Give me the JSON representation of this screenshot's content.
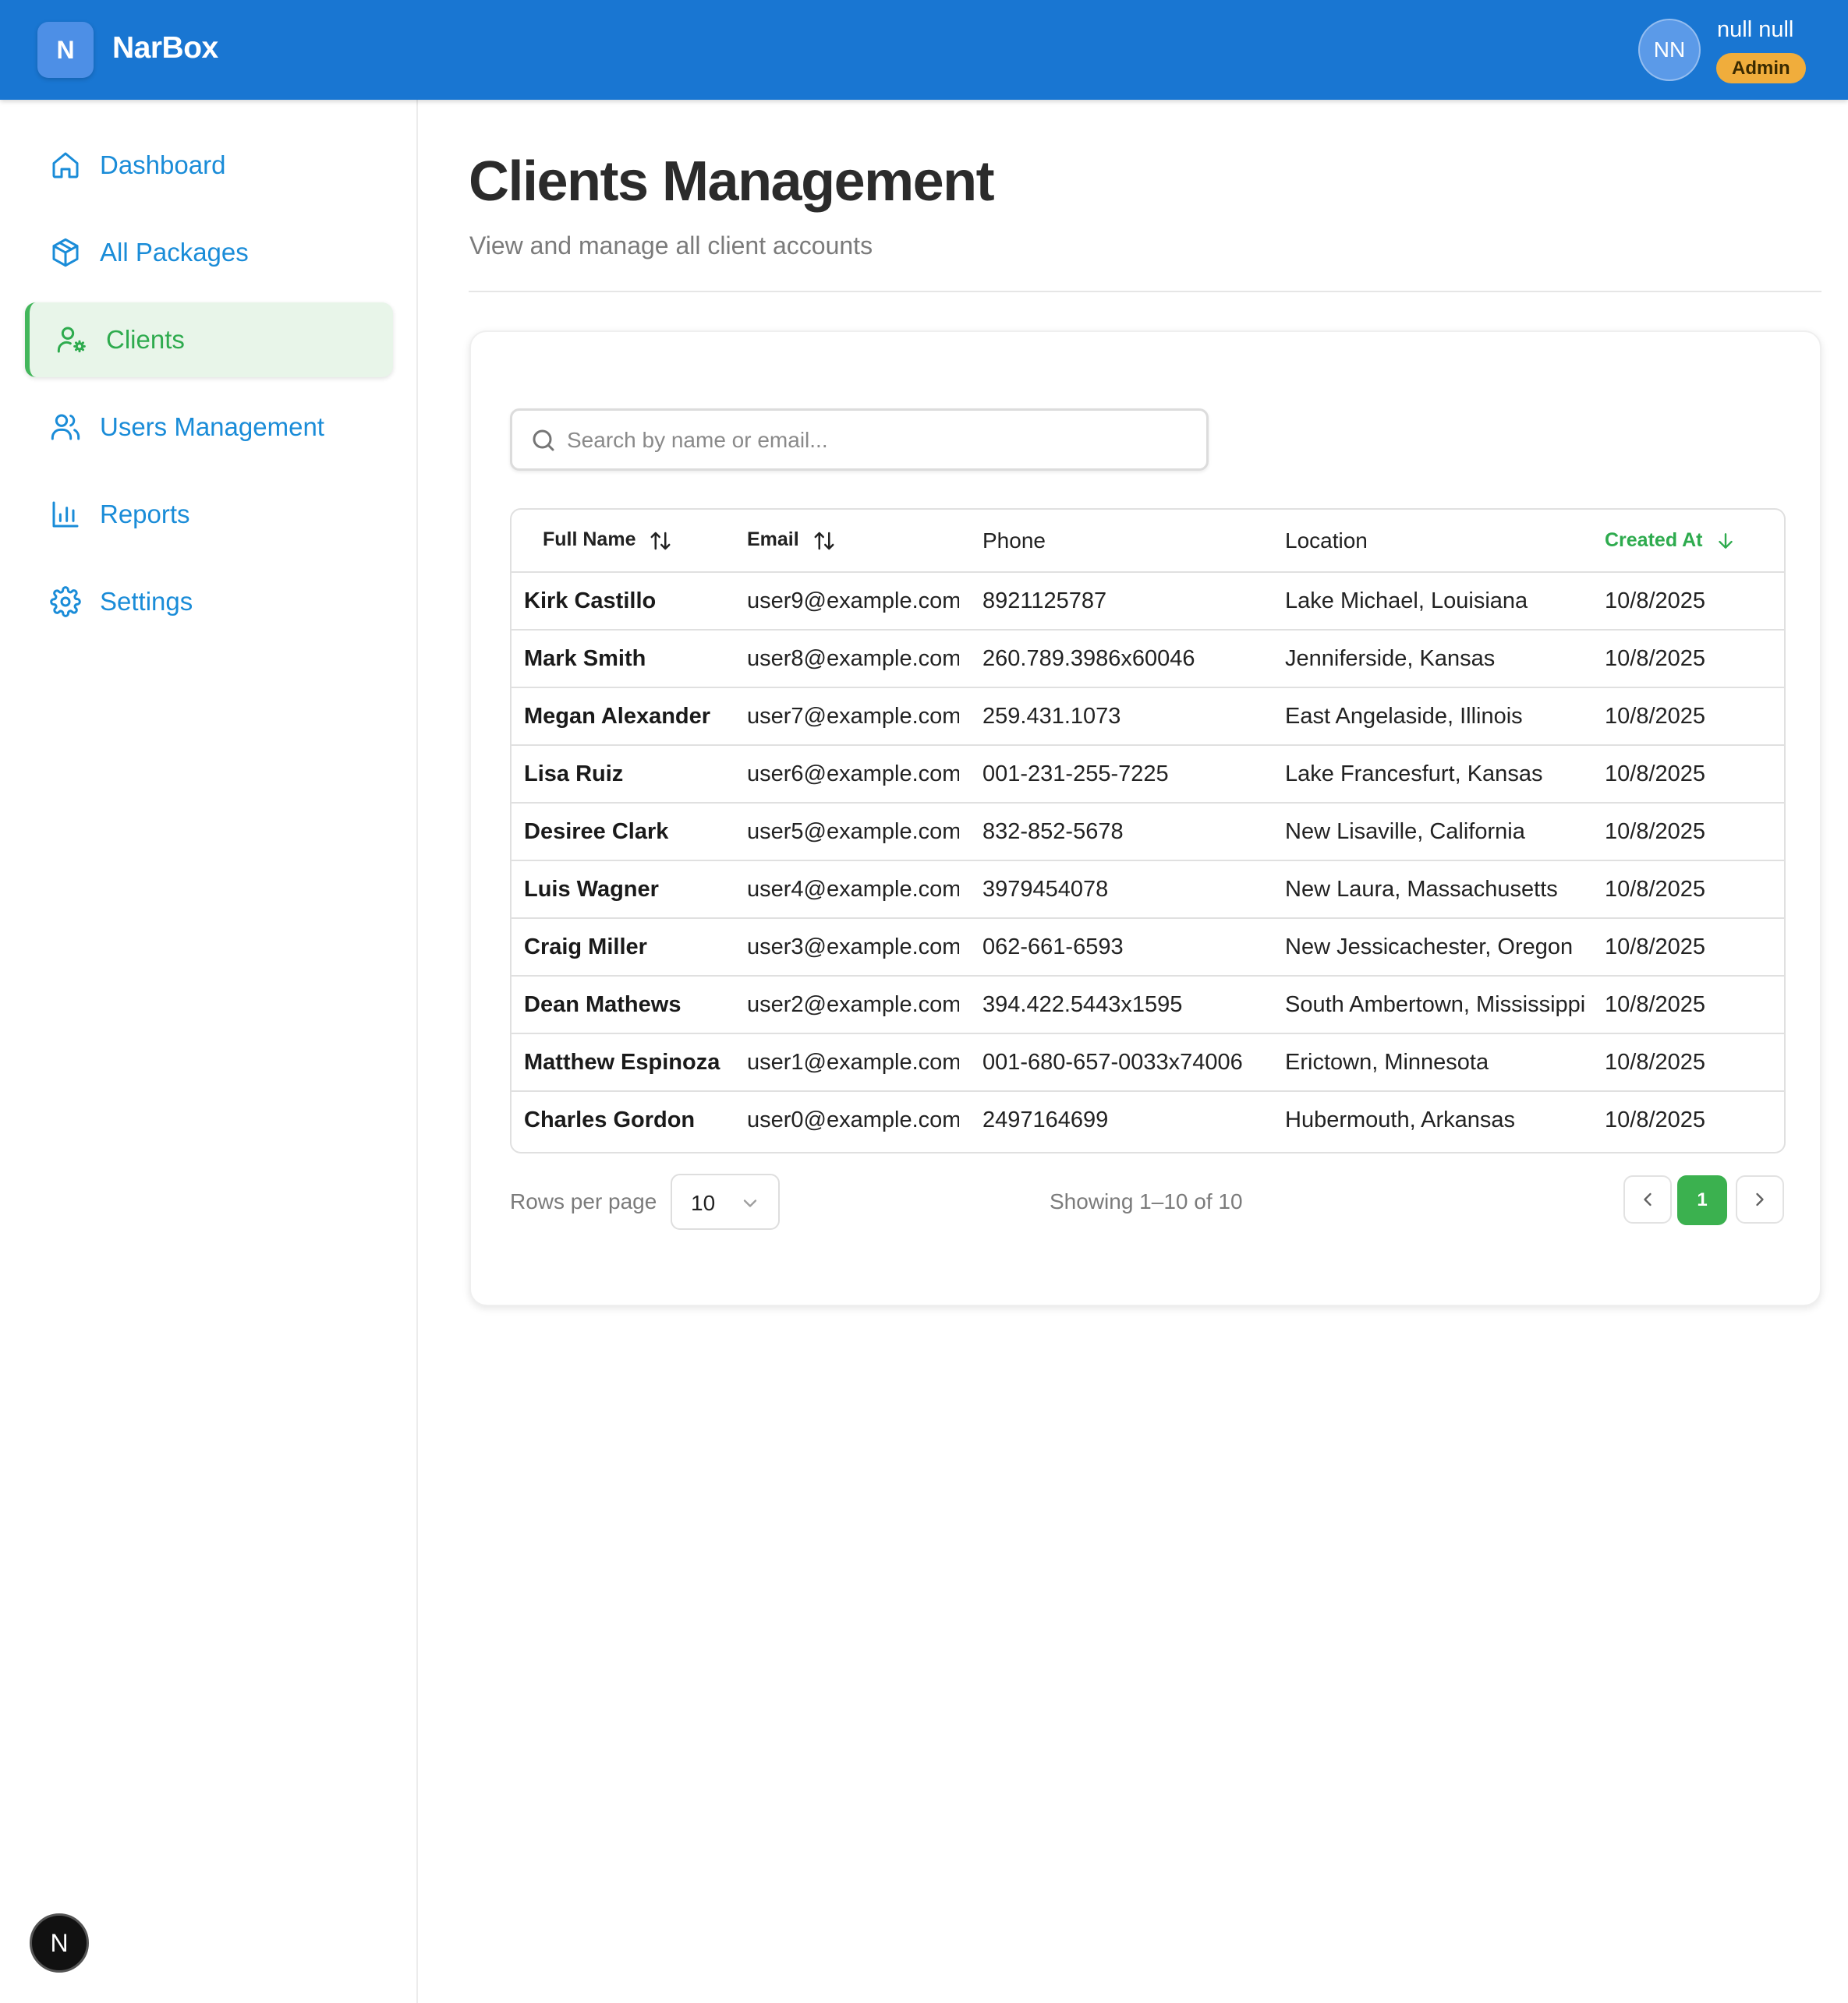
{
  "header": {
    "logo_letter": "N",
    "app_name": "NarBox",
    "user_initials": "NN",
    "user_name": "null null",
    "user_role": "Admin",
    "accent": "#1976d2"
  },
  "sidebar": {
    "items": [
      {
        "label": "Dashboard",
        "icon": "home-icon",
        "active": false
      },
      {
        "label": "All Packages",
        "icon": "package-icon",
        "active": false
      },
      {
        "label": "Clients",
        "icon": "user-cog-icon",
        "active": true
      },
      {
        "label": "Users Management",
        "icon": "users-icon",
        "active": false
      },
      {
        "label": "Reports",
        "icon": "bar-chart-icon",
        "active": false
      },
      {
        "label": "Settings",
        "icon": "gear-icon",
        "active": false
      }
    ],
    "active_color": "#2eab4e",
    "link_color": "#1a8cd8"
  },
  "dev_badge": {
    "letter": "N"
  },
  "page": {
    "title": "Clients Management",
    "subtitle": "View and manage all client accounts"
  },
  "search": {
    "placeholder": "Search by name or email...",
    "value": ""
  },
  "table": {
    "columns": [
      {
        "label": "Full Name",
        "sort": "both"
      },
      {
        "label": "Email",
        "sort": "both"
      },
      {
        "label": "Phone",
        "sort": "none"
      },
      {
        "label": "Location",
        "sort": "none"
      },
      {
        "label": "Created At",
        "sort": "desc"
      }
    ],
    "rows": [
      [
        "Kirk Castillo",
        "user9@example.com",
        "8921125787",
        "Lake Michael, Louisiana",
        "10/8/2025"
      ],
      [
        "Mark Smith",
        "user8@example.com",
        "260.789.3986x60046",
        "Jenniferside, Kansas",
        "10/8/2025"
      ],
      [
        "Megan Alexander",
        "user7@example.com",
        "259.431.1073",
        "East Angelaside, Illinois",
        "10/8/2025"
      ],
      [
        "Lisa Ruiz",
        "user6@example.com",
        "001-231-255-7225",
        "Lake Francesfurt, Kansas",
        "10/8/2025"
      ],
      [
        "Desiree Clark",
        "user5@example.com",
        "832-852-5678",
        "New Lisaville, California",
        "10/8/2025"
      ],
      [
        "Luis Wagner",
        "user4@example.com",
        "3979454078",
        "New Laura, Massachusetts",
        "10/8/2025"
      ],
      [
        "Craig Miller",
        "user3@example.com",
        "062-661-6593",
        "New Jessicachester, Oregon",
        "10/8/2025"
      ],
      [
        "Dean Mathews",
        "user2@example.com",
        "394.422.5443x1595",
        "South Ambertown, Mississippi",
        "10/8/2025"
      ],
      [
        "Matthew Espinoza",
        "user1@example.com",
        "001-680-657-0033x74006",
        "Erictown, Minnesota",
        "10/8/2025"
      ],
      [
        "Charles Gordon",
        "user0@example.com",
        "2497164699",
        "Hubermouth, Arkansas",
        "10/8/2025"
      ]
    ]
  },
  "pagination": {
    "rows_per_page_label": "Rows per page",
    "rows_per_page": "10",
    "showing": "Showing 1–10 of 10",
    "current_page": "1"
  }
}
